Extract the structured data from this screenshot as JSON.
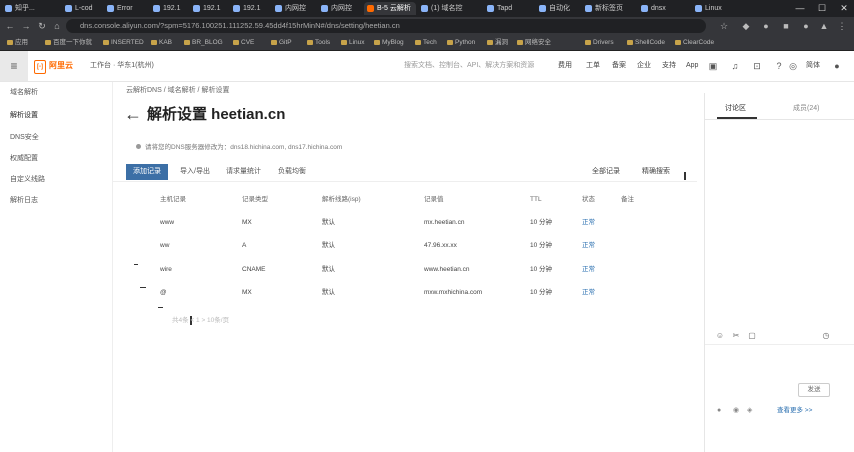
{
  "browser": {
    "tabs": [
      {
        "label": "知乎..."
      },
      {
        "label": "L-cod"
      },
      {
        "label": "Error"
      },
      {
        "label": "192.1"
      },
      {
        "label": "192.1"
      },
      {
        "label": "192.1"
      },
      {
        "label": "内网控"
      },
      {
        "label": "B-5 云解析"
      },
      {
        "label": "(1) 域名控"
      },
      {
        "label": "Tapd"
      },
      {
        "label": "自动化"
      },
      {
        "label": "新标签页"
      },
      {
        "label": "dnsx"
      },
      {
        "label": "Linux"
      }
    ],
    "window_controls": [
      "—",
      "☐",
      "✕"
    ],
    "url": "dns.console.aliyun.com/?spm=5176.100251.111252.59.45dd4f15hrMinN#/dns/setting/heetian.cn",
    "bookmarks": [
      "应用",
      "百度一下你就",
      "INSERTED",
      "KAB",
      "BR_BLOG",
      "CVE",
      "GitP",
      "Tools",
      "Linux",
      "MyBlog",
      "Tech",
      "Python",
      "漏洞",
      "网络安全",
      "Drivers",
      "ShellCode",
      "ClearCode"
    ]
  },
  "console": {
    "menu_icon": "menu-icon",
    "logo_text": "阿里云",
    "logo_badge": "[-]",
    "workbench": "工作台 · 华东1(杭州)",
    "search_placeholder": "搜索文档、控制台、API、解决方案和资源",
    "nav": [
      "费用",
      "工单",
      "备案",
      "企业",
      "支持",
      "App"
    ],
    "header_icons": [
      "terminal-icon",
      "bell-icon",
      "cart-icon",
      "help-icon",
      "globe-icon"
    ],
    "lang": "简体"
  },
  "sidebar": {
    "items": [
      "域名解析",
      "解析设置",
      "DNS安全",
      "权威配置",
      "自定义线路",
      "解析日志"
    ]
  },
  "main": {
    "breadcrumb": "云解析DNS / 域名解析 / 解析设置",
    "title": "解析设置 heetian.cn",
    "dns_info": "请将您的DNS服务器修改为：dns18.hichina.com, dns17.hichina.com",
    "toolbar": {
      "add": "添加记录",
      "import_export": "导入/导出",
      "batch": "请求量统计",
      "refresh": "负载均衡",
      "advanced": "全部记录",
      "search": "精确搜索"
    },
    "table": {
      "headers": [
        "主机记录",
        "记录类型",
        "解析线路(isp)",
        "记录值",
        "TTL",
        "状态",
        "备注"
      ],
      "rows": [
        {
          "host": "www",
          "type": "MX",
          "line": "默认",
          "value": "mx.heetian.cn",
          "ttl": "10 分钟",
          "status": "正常"
        },
        {
          "host": "ww",
          "type": "A",
          "line": "默认",
          "value": "47.96.xx.xx",
          "ttl": "10 分钟",
          "status": "正常"
        },
        {
          "host": "wire",
          "type": "CNAME",
          "line": "默认",
          "value": "www.heetian.cn",
          "ttl": "10 分钟",
          "status": "正常"
        },
        {
          "host": "@",
          "type": "MX",
          "line": "默认",
          "value": "mxw.mxhichina.com",
          "ttl": "10 分钟",
          "status": "正常"
        }
      ]
    },
    "pager": "共4条  <  1  >  10条/页"
  },
  "right_panel": {
    "tabs": [
      "讨论区",
      "成员(24)"
    ],
    "tools": [
      "emoji-icon",
      "scissors-icon",
      "image-icon",
      "history-icon"
    ],
    "send": "发送",
    "bottom_link": "查看更多 >>"
  }
}
